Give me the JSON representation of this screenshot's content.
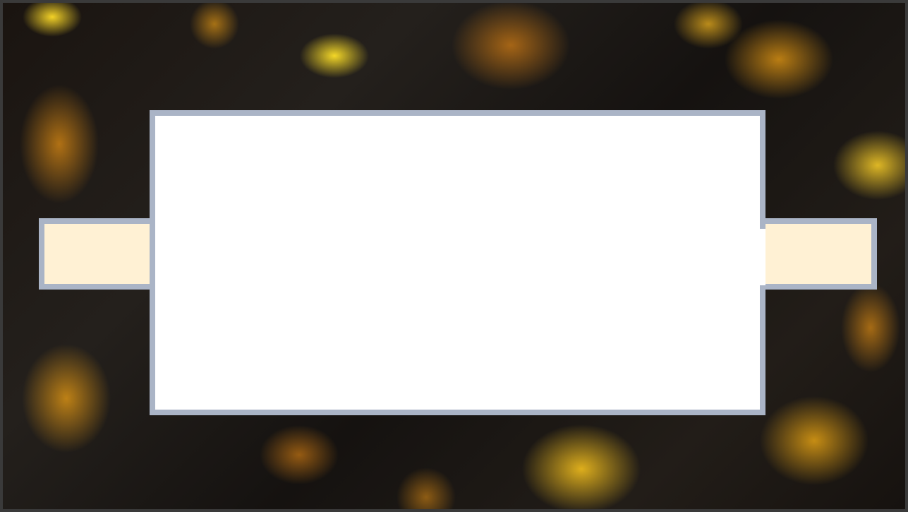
{
  "game": {
    "left_slot": {
      "label": ""
    },
    "right_slot": {
      "label": ""
    },
    "main_board": {
      "text": ""
    }
  },
  "colors": {
    "frame": "#aab4c6",
    "slot_fill": "#fff1d4",
    "board_fill": "#ffffff",
    "lava_glow": "#ffb300",
    "rock_dark": "#1a1410"
  }
}
